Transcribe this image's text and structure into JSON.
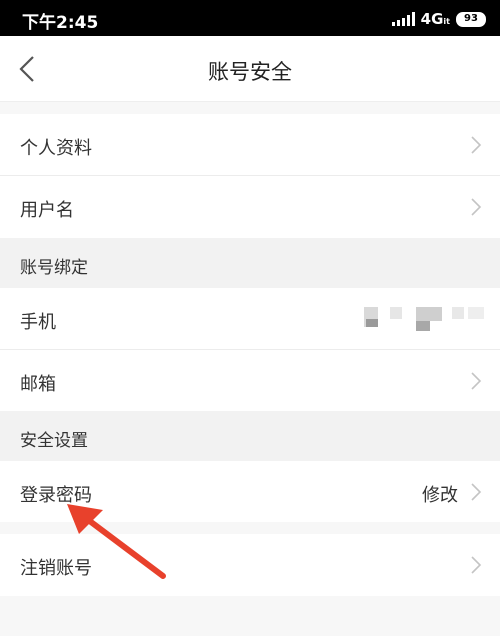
{
  "status_bar": {
    "time": "下午2:45",
    "network": "4G",
    "network_sub": "it",
    "battery": "93"
  },
  "nav": {
    "title": "账号安全"
  },
  "items": {
    "profile": "个人资料",
    "username": "用户名",
    "phone": "手机",
    "email": "邮箱",
    "password": "登录密码",
    "password_action": "修改",
    "deregister": "注销账号"
  },
  "sections": {
    "binding": "账号绑定",
    "security": "安全设置"
  },
  "colors": {
    "annotation_arrow": "#e8412c"
  },
  "icons": {
    "back": "chevron-left-icon",
    "row_arrow": "chevron-right-icon"
  }
}
